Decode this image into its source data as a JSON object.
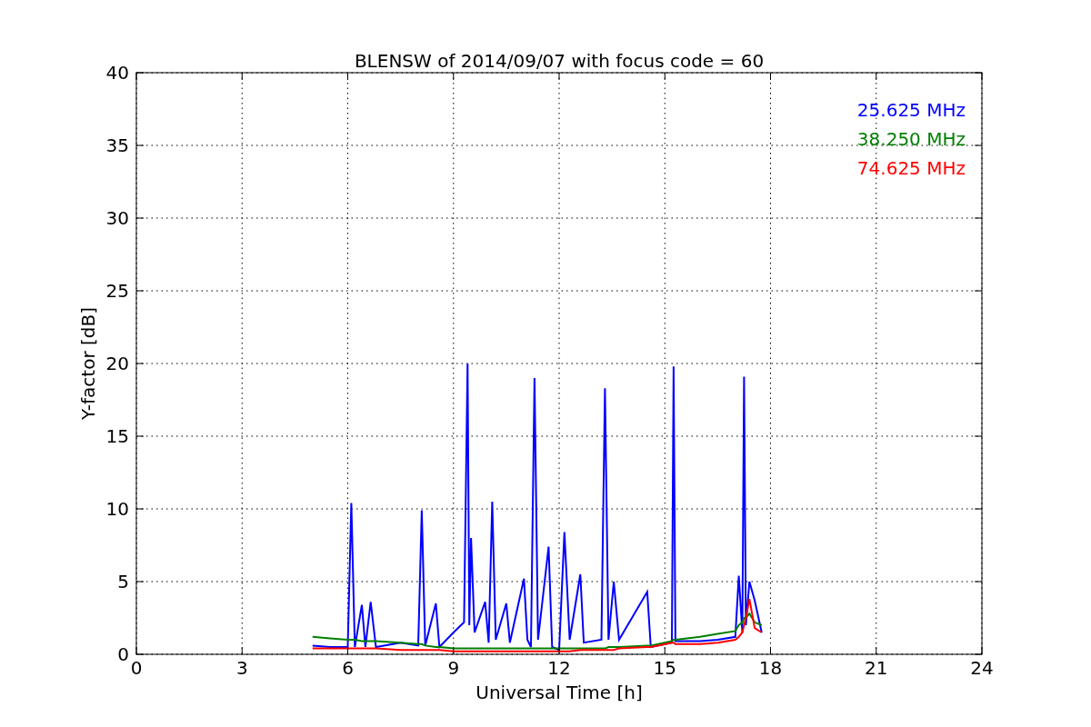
{
  "figure": {
    "chart_data": {
      "type": "line",
      "grid": true,
      "title": "BLENSW of 2014/09/07 with focus code = 60",
      "xlabel": "Universal Time [h]",
      "ylabel": "Y-factor [dB]",
      "xlim": [
        0,
        24
      ],
      "ylim": [
        0,
        40
      ],
      "xticks": [
        0,
        3,
        6,
        9,
        12,
        15,
        18,
        21,
        24
      ],
      "yticks": [
        0,
        5,
        10,
        15,
        20,
        25,
        30,
        35,
        40
      ],
      "x": [
        5,
        5.5,
        6,
        6.1,
        6.2,
        6.4,
        6.5,
        6.65,
        6.8,
        7.5,
        8.0,
        8.1,
        8.2,
        8.5,
        8.6,
        9.0,
        9.3,
        9.4,
        9.45,
        9.5,
        9.6,
        9.9,
        10.0,
        10.1,
        10.2,
        10.5,
        10.6,
        11.0,
        11.1,
        11.2,
        11.3,
        11.4,
        11.7,
        11.8,
        12.0,
        12.15,
        12.3,
        12.6,
        12.7,
        13.2,
        13.3,
        13.4,
        13.55,
        13.7,
        14.5,
        14.6,
        15.2,
        15.25,
        15.3,
        16.0,
        16.5,
        17.0,
        17.1,
        17.2,
        17.25,
        17.3,
        17.4,
        17.55,
        17.75
      ],
      "series": [
        {
          "name": "25.625 MHz",
          "color": "#0000ff",
          "values": [
            0.6,
            0.5,
            0.5,
            10.4,
            0.5,
            3.4,
            0.5,
            3.6,
            0.5,
            0.8,
            0.6,
            9.9,
            0.6,
            3.5,
            0.5,
            1.5,
            2.2,
            20.0,
            2.0,
            8.0,
            1.5,
            3.6,
            0.8,
            10.5,
            1.0,
            3.5,
            0.8,
            5.2,
            1.0,
            0.5,
            19.0,
            1.0,
            7.4,
            0.5,
            0.3,
            8.4,
            1.0,
            5.5,
            0.8,
            1.0,
            18.3,
            1.0,
            5.0,
            1.0,
            4.3,
            0.5,
            0.8,
            19.8,
            0.9,
            0.9,
            1.0,
            1.2,
            5.4,
            1.5,
            19.1,
            2.0,
            5.0,
            3.7,
            1.5
          ]
        },
        {
          "name": "38.250 MHz",
          "color": "#008000",
          "values": [
            1.2,
            1.1,
            1.0,
            1.0,
            1.0,
            0.9,
            0.9,
            0.9,
            0.9,
            0.8,
            0.7,
            0.7,
            0.6,
            0.5,
            0.5,
            0.4,
            0.4,
            0.4,
            0.4,
            0.4,
            0.4,
            0.4,
            0.4,
            0.4,
            0.4,
            0.4,
            0.4,
            0.4,
            0.4,
            0.4,
            0.4,
            0.4,
            0.4,
            0.4,
            0.4,
            0.4,
            0.4,
            0.4,
            0.4,
            0.4,
            0.4,
            0.5,
            0.5,
            0.5,
            0.6,
            0.6,
            0.9,
            1.0,
            1.0,
            1.2,
            1.4,
            1.6,
            2.0,
            2.2,
            2.5,
            2.5,
            2.8,
            2.2,
            2.0
          ]
        },
        {
          "name": "74.625 MHz",
          "color": "#ff0000",
          "values": [
            0.4,
            0.4,
            0.4,
            0.4,
            0.4,
            0.4,
            0.4,
            0.4,
            0.4,
            0.3,
            0.3,
            0.3,
            0.3,
            0.3,
            0.3,
            0.2,
            0.2,
            0.2,
            0.2,
            0.2,
            0.2,
            0.2,
            0.2,
            0.2,
            0.2,
            0.2,
            0.2,
            0.2,
            0.2,
            0.2,
            0.2,
            0.2,
            0.2,
            0.2,
            0.2,
            0.2,
            0.2,
            0.3,
            0.3,
            0.3,
            0.3,
            0.3,
            0.3,
            0.4,
            0.5,
            0.5,
            0.8,
            0.8,
            0.7,
            0.7,
            0.8,
            1.0,
            1.2,
            1.5,
            2.0,
            2.5,
            3.8,
            1.8,
            1.5
          ]
        }
      ]
    }
  }
}
